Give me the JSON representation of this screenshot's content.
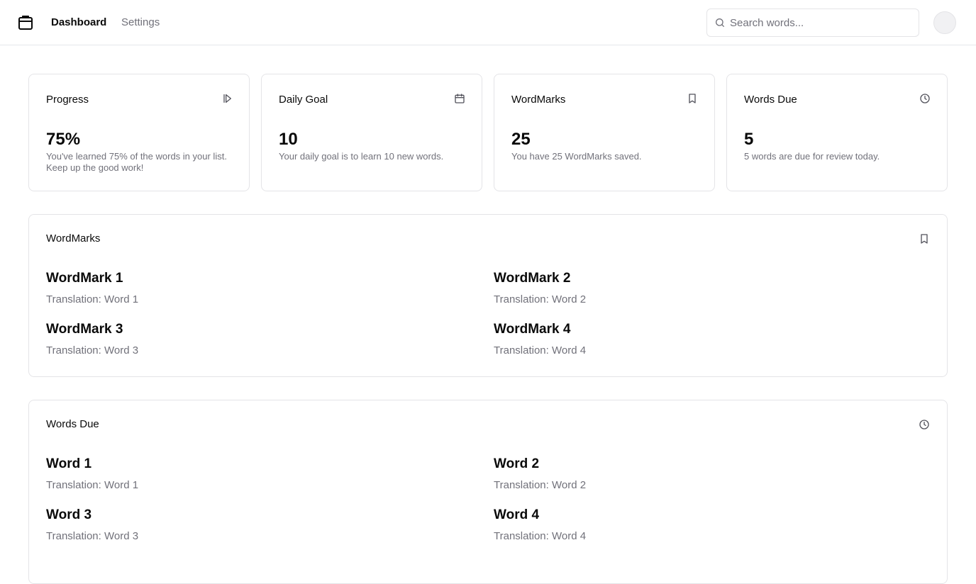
{
  "nav": {
    "logo_icon": "package-icon",
    "links": [
      "Dashboard",
      "Settings"
    ]
  },
  "search": {
    "placeholder": "Search words...",
    "value": ""
  },
  "stats": [
    {
      "title": "Progress",
      "icon": "play-step-icon",
      "value": "75%",
      "description": "You've learned 75% of the words in your list. Keep up the good work!"
    },
    {
      "title": "Daily Goal",
      "icon": "calendar-icon",
      "value": "10",
      "description": "Your daily goal is to learn 10 new words."
    },
    {
      "title": "WordMarks",
      "icon": "bookmark-icon",
      "value": "25",
      "description": "You have 25 WordMarks saved."
    },
    {
      "title": "Words Due",
      "icon": "clock-icon",
      "value": "5",
      "description": "5 words are due for review today."
    }
  ],
  "wordmarks": {
    "title": "WordMarks",
    "icon": "bookmark-icon",
    "items": [
      {
        "title": "WordMark 1",
        "translation": "Translation: Word 1"
      },
      {
        "title": "WordMark 2",
        "translation": "Translation: Word 2"
      },
      {
        "title": "WordMark 3",
        "translation": "Translation: Word 3"
      },
      {
        "title": "WordMark 4",
        "translation": "Translation: Word 4"
      }
    ]
  },
  "words_due": {
    "title": "Words Due",
    "icon": "clock-icon",
    "items": [
      {
        "title": "Word 1",
        "translation": "Translation: Word 1"
      },
      {
        "title": "Word 2",
        "translation": "Translation: Word 2"
      },
      {
        "title": "Word 3",
        "translation": "Translation: Word 3"
      },
      {
        "title": "Word 4",
        "translation": "Translation: Word 4"
      }
    ]
  }
}
